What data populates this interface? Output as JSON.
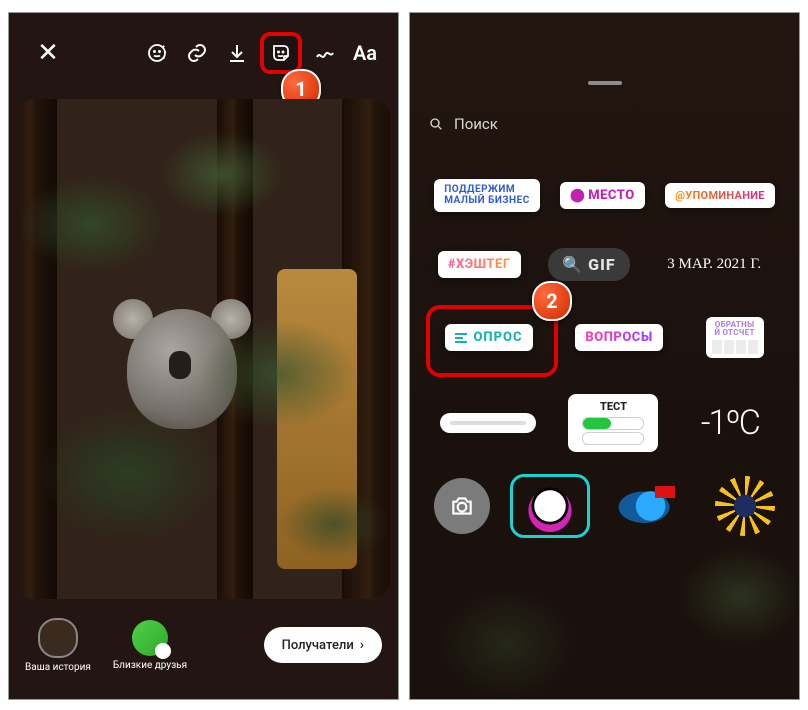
{
  "left": {
    "toolbar": {
      "close": "✕",
      "text_tool": "Aa"
    },
    "bottom": {
      "your_story": "Ваша история",
      "close_friends": "Близкие друзья",
      "recipients": "Получатели"
    },
    "callout": "1"
  },
  "right": {
    "search_placeholder": "Поиск",
    "stickers": {
      "support_biz": "ПОДДЕРЖИМ\nМАЛЫЙ БИЗНЕС",
      "place": "МЕСТО",
      "mention": "@УПОМИНАНИЕ",
      "hashtag": "#ХЭШТЕГ",
      "gif": "GIF",
      "date": "3 МАР. 2021 Г.",
      "poll": "ОПРОС",
      "questions": "ВОПРОСЫ",
      "countdown": "ОБРАТНЫ\nЙ ОТСЧЕТ",
      "quiz": "ТЕСТ",
      "temperature": "-1ºC"
    },
    "callout": "2"
  }
}
